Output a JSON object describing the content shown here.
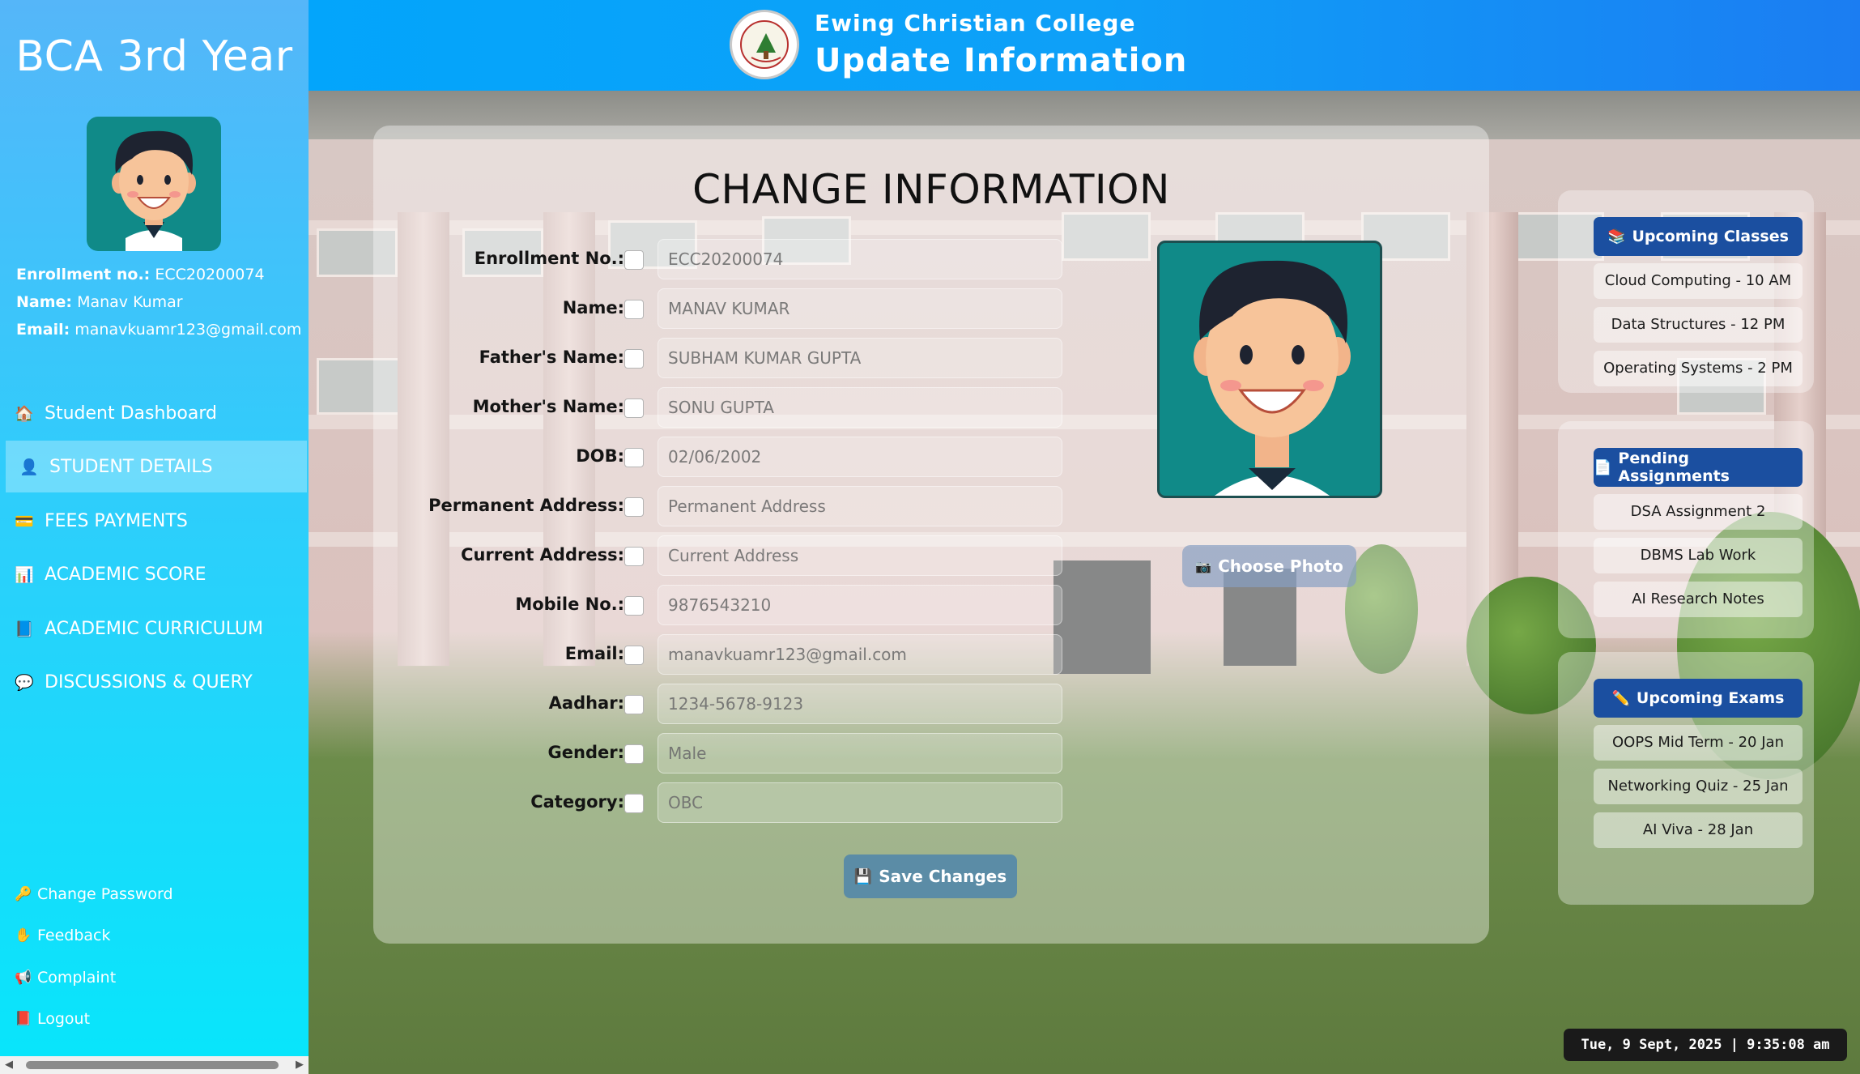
{
  "sidebar": {
    "title": "BCA 3rd Year",
    "enrollment_label": "Enrollment no.:",
    "enrollment_value": "ECC20200074",
    "name_label": "Name:",
    "name_value": "Manav Kumar",
    "email_label": "Email:",
    "email_value": "manavkuamr123@gmail.com",
    "nav": [
      {
        "label": "Student Dashboard",
        "icon": "house-icon"
      },
      {
        "label": "STUDENT DETAILS",
        "icon": "student-icon"
      },
      {
        "label": "FEES PAYMENTS",
        "icon": "credit-card-icon"
      },
      {
        "label": "ACADEMIC SCORE",
        "icon": "bar-chart-icon"
      },
      {
        "label": "ACADEMIC CURRICULUM",
        "icon": "book-icon"
      },
      {
        "label": "DISCUSSIONS & QUERY",
        "icon": "speech-bubble-icon"
      }
    ],
    "footer": [
      {
        "label": "Change Password",
        "icon": "key-icon"
      },
      {
        "label": "Feedback",
        "icon": "hand-icon"
      },
      {
        "label": "Complaint",
        "icon": "megaphone-icon"
      },
      {
        "label": "Logout",
        "icon": "logout-icon"
      }
    ]
  },
  "header": {
    "college": "Ewing Christian College",
    "page_title": "Update Information"
  },
  "form": {
    "title": "CHANGE INFORMATION",
    "fields": [
      {
        "label": "Enrollment No.:",
        "placeholder": "ECC20200074"
      },
      {
        "label": "Name:",
        "placeholder": "MANAV KUMAR"
      },
      {
        "label": "Father's Name:",
        "placeholder": "SUBHAM KUMAR GUPTA"
      },
      {
        "label": "Mother's Name:",
        "placeholder": "SONU GUPTA"
      },
      {
        "label": "DOB:",
        "placeholder": "02/06/2002"
      },
      {
        "label": "Permanent Address:",
        "placeholder": "Permanent Address"
      },
      {
        "label": "Current Address:",
        "placeholder": "Current Address"
      },
      {
        "label": "Mobile No.:",
        "placeholder": "9876543210"
      },
      {
        "label": "Email:",
        "placeholder": "manavkuamr123@gmail.com"
      },
      {
        "label": "Aadhar:",
        "placeholder": "1234-5678-9123"
      },
      {
        "label": "Gender:",
        "placeholder": "Male"
      },
      {
        "label": "Category:",
        "placeholder": "OBC"
      }
    ],
    "choose_photo": "Choose Photo",
    "save_changes": "Save Changes"
  },
  "widgets": {
    "classes": {
      "title": "Upcoming Classes",
      "items": [
        "Cloud Computing - 10 AM",
        "Data Structures - 12 PM",
        "Operating Systems - 2 PM"
      ]
    },
    "assignments": {
      "title": "Pending Assignments",
      "items": [
        "DSA Assignment 2",
        "DBMS Lab Work",
        "AI Research Notes"
      ]
    },
    "exams": {
      "title": "Upcoming Exams",
      "items": [
        "OOPS Mid Term - 20 Jan",
        "Networking Quiz - 25 Jan",
        "AI Viva - 28 Jan"
      ]
    }
  },
  "clock": "Tue, 9 Sept, 2025 | 9:35:08 am",
  "colors": {
    "sidebar_top": "#55b6f9",
    "sidebar_bottom": "#07e6fb",
    "header": "#03a5fb",
    "widget_button": "#1b4fa0",
    "avatar_bg": "#108a88"
  }
}
